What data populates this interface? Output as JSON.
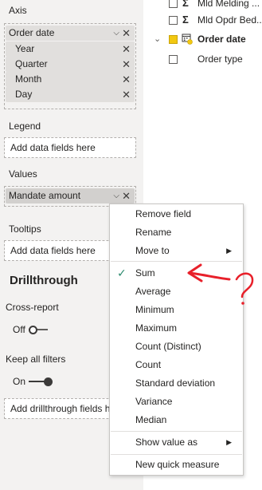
{
  "left_panel": {
    "axis": {
      "label": "Axis",
      "field": "Order date",
      "sub_items": [
        "Year",
        "Quarter",
        "Month",
        "Day"
      ]
    },
    "legend": {
      "label": "Legend",
      "placeholder": "Add data fields here"
    },
    "values": {
      "label": "Values",
      "field": "Mandate amount"
    },
    "tooltips": {
      "label": "Tooltips",
      "placeholder": "Add data fields here"
    },
    "drillthrough": {
      "title": "Drillthrough",
      "cross_report_label": "Cross-report",
      "cross_report_state": "Off",
      "keep_filters_label": "Keep all filters",
      "keep_filters_state": "On",
      "add_fields": "Add drillthrough fields h"
    }
  },
  "field_list": {
    "items": [
      {
        "name": "Mld Melding ...",
        "checked": false,
        "icon": "sigma-icon"
      },
      {
        "name": "Mld Opdr Bed...",
        "checked": false,
        "icon": "sigma-icon"
      },
      {
        "name": "Order date",
        "checked": true,
        "icon": "date-hierarchy-icon"
      },
      {
        "name": "Order type",
        "checked": false,
        "icon": ""
      }
    ],
    "sigma": "Σ",
    "collapse_glyph": "⌄"
  },
  "context_menu": {
    "items": [
      {
        "label": "Remove field"
      },
      {
        "label": "Rename"
      },
      {
        "label": "Move to",
        "submenu": true
      },
      {
        "label": "Sum",
        "checked": true
      },
      {
        "label": "Average"
      },
      {
        "label": "Minimum"
      },
      {
        "label": "Maximum"
      },
      {
        "label": "Count (Distinct)"
      },
      {
        "label": "Count"
      },
      {
        "label": "Standard deviation"
      },
      {
        "label": "Variance"
      },
      {
        "label": "Median"
      },
      {
        "label": "Show value as",
        "submenu": true
      },
      {
        "label": "New quick measure"
      }
    ],
    "check_glyph": "✓",
    "arrow_glyph": "▶"
  },
  "glyphs": {
    "close": "✕",
    "chevron": "⌵"
  },
  "colors": {
    "accent_check": "#2c8a6e",
    "checkbox_checked": "#f2c811",
    "annotation_red": "#e8202a"
  }
}
